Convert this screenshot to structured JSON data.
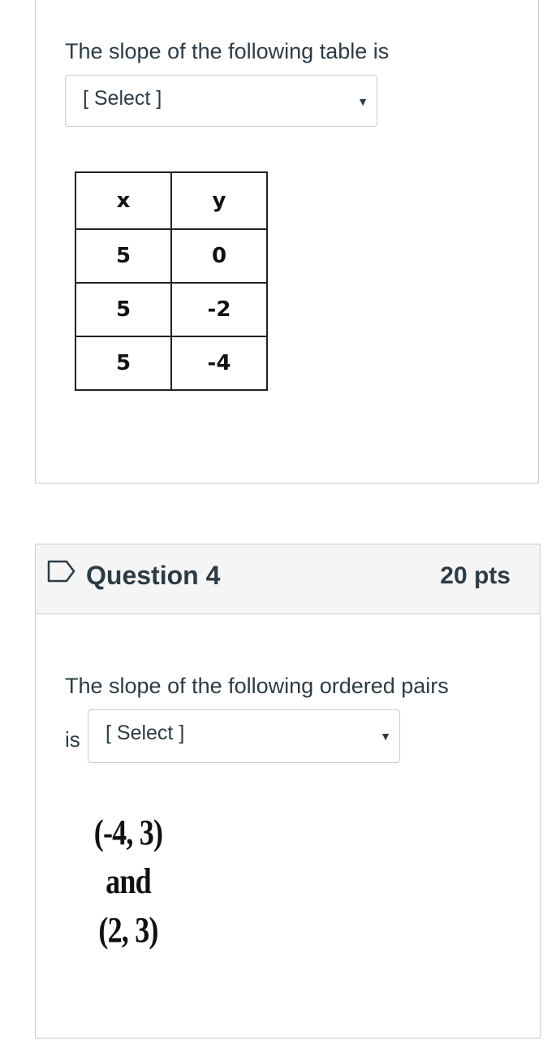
{
  "question3": {
    "prompt": "The slope of the following table is",
    "select_value": "[ Select ]",
    "select_arrow": "▼",
    "table": {
      "headers": [
        "x",
        "y"
      ],
      "rows": [
        [
          "5",
          "0"
        ],
        [
          "5",
          "-2"
        ],
        [
          "5",
          "-4"
        ]
      ]
    }
  },
  "question4": {
    "title": "Question 4",
    "points": "20 pts",
    "prompt_line1": "The slope of the following ordered pairs",
    "prompt_line2": "is",
    "select_value": "[ Select ]",
    "select_arrow": "▼",
    "pairs": [
      "(-4, 3)",
      "and",
      "(2, 3)"
    ]
  }
}
